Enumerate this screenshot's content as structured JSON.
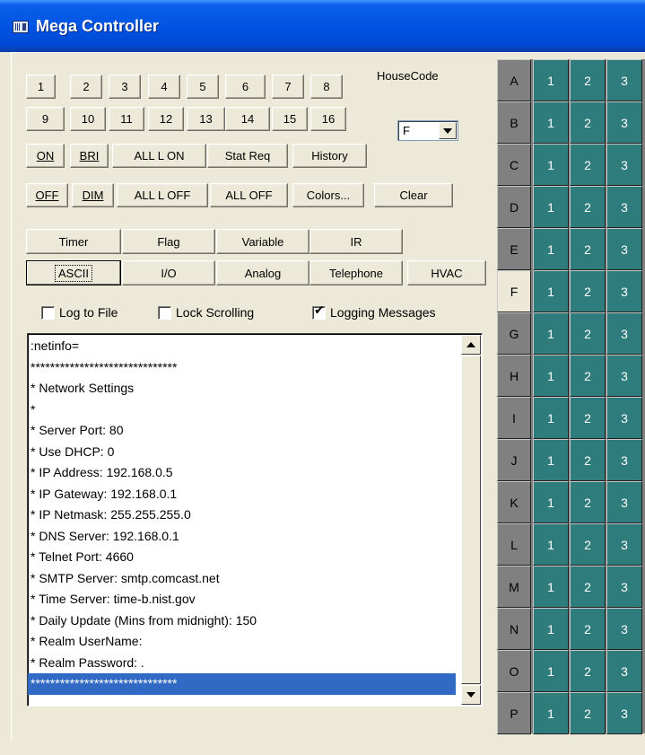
{
  "window": {
    "title": "Mega Controller"
  },
  "number_buttons": [
    "1",
    "2",
    "3",
    "4",
    "5",
    "6",
    "7",
    "8",
    "9",
    "10",
    "11",
    "12",
    "13",
    "14",
    "15",
    "16"
  ],
  "command_row1": {
    "on": "ON",
    "bri": "BRI",
    "all_l_on": "ALL L ON",
    "stat_req": "Stat Req",
    "history": "History"
  },
  "command_row2": {
    "off": "OFF",
    "dim": "DIM",
    "all_l_off": "ALL L OFF",
    "all_off": "ALL OFF",
    "colors": "Colors...",
    "clear": "Clear"
  },
  "tabs_row1": {
    "timer": "Timer",
    "flag": "Flag",
    "variable": "Variable",
    "ir": "IR"
  },
  "tabs_row2": {
    "ascii": "ASCII",
    "io": "I/O",
    "analog": "Analog",
    "telephone": "Telephone",
    "hvac": "HVAC"
  },
  "housecode": {
    "label": "HouseCode",
    "value": "F"
  },
  "checkboxes": {
    "log_to_file": {
      "label": "Log to File",
      "checked": false
    },
    "lock_scrolling": {
      "label": "Lock Scrolling",
      "checked": false
    },
    "logging_messages": {
      "label": "Logging Messages",
      "checked": true
    }
  },
  "log": {
    "lines": [
      ":netinfo=",
      "******************************",
      "* Network Settings",
      "*",
      "* Server Port: 80",
      "* Use DHCP: 0",
      "* IP Address: 192.168.0.5",
      "* IP Gateway: 192.168.0.1",
      "* IP Netmask: 255.255.255.0",
      "* DNS Server: 192.168.0.1",
      "* Telnet Port: 4660",
      "* SMTP Server: smtp.comcast.net",
      "* Time Server: time-b.nist.gov",
      "* Daily Update (Mins from midnight): 150",
      "* Realm UserName:",
      "* Realm Password: .",
      "******************************"
    ],
    "selected_index": 16
  },
  "grid": {
    "letters": [
      "A",
      "B",
      "C",
      "D",
      "E",
      "F",
      "G",
      "H",
      "I",
      "J",
      "K",
      "L",
      "M",
      "N",
      "O",
      "P"
    ],
    "active_letter": "F",
    "units": [
      "1",
      "2",
      "3"
    ]
  },
  "colors": {
    "titlebar": "#0054e3",
    "selection": "#316ac5",
    "grid_cell": "#2e7c7c",
    "grid_letter": "#808080",
    "window_bg": "#ece9d8"
  }
}
